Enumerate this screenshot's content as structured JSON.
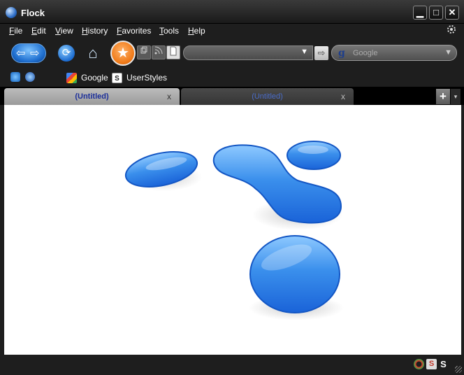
{
  "window": {
    "title": "Flock",
    "minimize_glyph": "▁",
    "maximize_glyph": "□",
    "close_glyph": "✕"
  },
  "menu": {
    "items": [
      {
        "first": "F",
        "rest": "ile"
      },
      {
        "first": "E",
        "rest": "dit"
      },
      {
        "first": "V",
        "rest": "iew"
      },
      {
        "first": "H",
        "rest": "istory"
      },
      {
        "first": "F",
        "rest": "avorites"
      },
      {
        "first": "T",
        "rest": "ools"
      },
      {
        "first": "H",
        "rest": "elp"
      }
    ]
  },
  "toolbar": {
    "back_glyph": "⇦",
    "forward_glyph": "⇨",
    "reload_glyph": "⟳",
    "home_glyph": "⌂",
    "star_glyph": "★",
    "url_value": "",
    "go_glyph": "⇨",
    "search_engine_glyph": "g",
    "search_placeholder": "Google",
    "dropdown_glyph": "▼"
  },
  "bookmarks": [
    {
      "label": "Google",
      "icon": "google-icon"
    },
    {
      "label": "UserStyles",
      "icon": "userstyles-icon"
    }
  ],
  "tabs": [
    {
      "label": "(Untitled)",
      "active": true,
      "close_glyph": "x"
    },
    {
      "label": "(Untitled)",
      "active": false,
      "close_glyph": "x"
    }
  ],
  "newtab_glyph": "+",
  "tabmenu_glyph": "▾",
  "status": {
    "icons": [
      "flock-status-icon",
      "stylish-icon",
      "s-icon"
    ],
    "stylish_glyph": "S",
    "s_glyph": "S"
  },
  "colors": {
    "accent_blue": "#2f7ee0",
    "star_orange": "#f07a18",
    "active_tab_text": "#1c2f9a"
  }
}
